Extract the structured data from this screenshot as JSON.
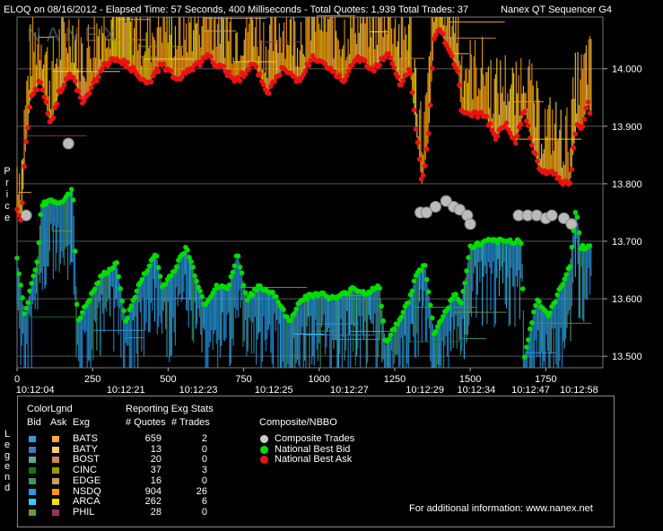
{
  "header": {
    "left": "ELOQ on 08/16/2012  -  Elapsed Time: 57 Seconds, 400 Milliseconds  -  Total Quotes: 1,939  Total Trades: 37",
    "right": "Nanex QT Sequencer G4"
  },
  "watermark": "NANEX",
  "yaxis_label": "Price",
  "legend_side_label": "Legend",
  "legend": {
    "title": "ColorLgnd",
    "stats_title": "Reporting Exg Stats",
    "col_bid": "Bid",
    "col_ask": "Ask",
    "col_exg": "Exg",
    "col_quotes": "# Quotes",
    "col_trades": "# Trades",
    "composite_title": "Composite/NBBO",
    "exchanges": [
      {
        "name": "BATS",
        "quotes": "659",
        "trades": "2",
        "bid_color": "#3399dd",
        "ask_color": "#ffaa33"
      },
      {
        "name": "BATY",
        "quotes": "13",
        "trades": "0",
        "bid_color": "#4477bb",
        "ask_color": "#ffcc66"
      },
      {
        "name": "BOST",
        "quotes": "20",
        "trades": "0",
        "bid_color": "#55aa99",
        "ask_color": "#cc8855"
      },
      {
        "name": "CINC",
        "quotes": "37",
        "trades": "3",
        "bid_color": "#117711",
        "ask_color": "#999900"
      },
      {
        "name": "EDGE",
        "quotes": "16",
        "trades": "0",
        "bid_color": "#339966",
        "ask_color": "#cc9966"
      },
      {
        "name": "NSDQ",
        "quotes": "904",
        "trades": "26",
        "bid_color": "#2299ee",
        "ask_color": "#ff9900"
      },
      {
        "name": "ARCA",
        "quotes": "262",
        "trades": "6",
        "bid_color": "#33ccff",
        "ask_color": "#ffdd00"
      },
      {
        "name": "PHIL",
        "quotes": "28",
        "trades": "0",
        "bid_color": "#669944",
        "ask_color": "#993366"
      }
    ],
    "composite": [
      {
        "label": "Composite Trades",
        "color": "#cccccc"
      },
      {
        "label": "National Best Bid",
        "color": "#00dd00"
      },
      {
        "label": "National Best Ask",
        "color": "#ee1111"
      }
    ],
    "footer": "For additional information: www.nanex.net"
  },
  "chart_data": {
    "type": "scatter",
    "title": "",
    "ylabel": "Price",
    "ylim": [
      13.48,
      14.09
    ],
    "xlim": [
      0,
      1939
    ],
    "y_ticks": [
      "13.500",
      "13.600",
      "13.700",
      "13.800",
      "13.900",
      "14.000"
    ],
    "x_ticks": [
      "0",
      "250",
      "500",
      "750",
      "1000",
      "1250",
      "1500",
      "1750"
    ],
    "time_labels": [
      {
        "quote": 60,
        "label": "10:12:04"
      },
      {
        "quote": 360,
        "label": "10:12:21"
      },
      {
        "quote": 600,
        "label": "10:12:23"
      },
      {
        "quote": 850,
        "label": "10:12:25"
      },
      {
        "quote": 1100,
        "label": "10:12:27"
      },
      {
        "quote": 1350,
        "label": "10:12:29"
      },
      {
        "quote": 1520,
        "label": "10:12:34"
      },
      {
        "quote": 1700,
        "label": "10:12:47"
      },
      {
        "quote": 1860,
        "label": "10:12:58"
      }
    ],
    "series": [
      {
        "name": "Composite Trades",
        "points": [
          [
            30,
            13.745
          ],
          [
            170,
            13.87
          ],
          [
            1335,
            13.75
          ],
          [
            1355,
            13.75
          ],
          [
            1385,
            13.76
          ],
          [
            1420,
            13.77
          ],
          [
            1445,
            13.76
          ],
          [
            1465,
            13.755
          ],
          [
            1490,
            13.745
          ],
          [
            1500,
            13.73
          ],
          [
            1660,
            13.745
          ],
          [
            1690,
            13.745
          ],
          [
            1720,
            13.745
          ],
          [
            1750,
            13.74
          ],
          [
            1770,
            13.745
          ],
          [
            1810,
            13.74
          ],
          [
            1835,
            13.73
          ]
        ]
      },
      {
        "name": "National Best Bid",
        "anchors": [
          [
            0,
            13.67
          ],
          [
            25,
            13.57
          ],
          [
            35,
            13.59
          ],
          [
            45,
            13.62
          ],
          [
            60,
            13.65
          ],
          [
            70,
            13.68
          ],
          [
            80,
            13.76
          ],
          [
            100,
            13.77
          ],
          [
            150,
            13.77
          ],
          [
            170,
            13.78
          ],
          [
            185,
            13.79
          ],
          [
            200,
            13.56
          ],
          [
            240,
            13.6
          ],
          [
            280,
            13.64
          ],
          [
            330,
            13.66
          ],
          [
            360,
            13.56
          ],
          [
            400,
            13.62
          ],
          [
            420,
            13.64
          ],
          [
            460,
            13.68
          ],
          [
            480,
            13.62
          ],
          [
            520,
            13.65
          ],
          [
            560,
            13.69
          ],
          [
            620,
            13.59
          ],
          [
            660,
            13.62
          ],
          [
            700,
            13.62
          ],
          [
            730,
            13.68
          ],
          [
            760,
            13.6
          ],
          [
            800,
            13.62
          ],
          [
            850,
            13.61
          ],
          [
            900,
            13.56
          ],
          [
            940,
            13.6
          ],
          [
            1000,
            13.61
          ],
          [
            1050,
            13.6
          ],
          [
            1090,
            13.61
          ],
          [
            1110,
            13.62
          ],
          [
            1150,
            13.61
          ],
          [
            1200,
            13.62
          ],
          [
            1220,
            13.52
          ],
          [
            1260,
            13.56
          ],
          [
            1300,
            13.6
          ],
          [
            1320,
            13.64
          ],
          [
            1350,
            13.66
          ],
          [
            1380,
            13.54
          ],
          [
            1420,
            13.58
          ],
          [
            1450,
            13.61
          ],
          [
            1470,
            13.59
          ],
          [
            1500,
            13.69
          ],
          [
            1560,
            13.7
          ],
          [
            1600,
            13.7
          ],
          [
            1650,
            13.7
          ],
          [
            1670,
            13.7
          ],
          [
            1680,
            13.5
          ],
          [
            1700,
            13.55
          ],
          [
            1720,
            13.6
          ],
          [
            1760,
            13.57
          ],
          [
            1800,
            13.62
          ],
          [
            1830,
            13.66
          ],
          [
            1850,
            13.76
          ],
          [
            1865,
            13.69
          ],
          [
            1900,
            13.69
          ]
        ]
      },
      {
        "name": "National Best Ask",
        "anchors": [
          [
            0,
            13.75
          ],
          [
            15,
            13.74
          ],
          [
            25,
            13.84
          ],
          [
            45,
            13.95
          ],
          [
            80,
            13.98
          ],
          [
            110,
            13.9
          ],
          [
            140,
            13.96
          ],
          [
            180,
            13.99
          ],
          [
            220,
            13.94
          ],
          [
            280,
            14.0
          ],
          [
            330,
            14.02
          ],
          [
            380,
            14.0
          ],
          [
            430,
            13.97
          ],
          [
            480,
            14.01
          ],
          [
            530,
            13.98
          ],
          [
            580,
            14.0
          ],
          [
            630,
            14.02
          ],
          [
            680,
            14.0
          ],
          [
            730,
            13.98
          ],
          [
            780,
            14.01
          ],
          [
            830,
            13.96
          ],
          [
            880,
            14.0
          ],
          [
            930,
            13.98
          ],
          [
            980,
            14.02
          ],
          [
            1030,
            14.0
          ],
          [
            1080,
            13.98
          ],
          [
            1130,
            14.02
          ],
          [
            1180,
            14.0
          ],
          [
            1230,
            14.03
          ],
          [
            1270,
            13.97
          ],
          [
            1300,
            14.0
          ],
          [
            1340,
            13.8
          ],
          [
            1360,
            13.87
          ],
          [
            1380,
            14.05
          ],
          [
            1400,
            14.07
          ],
          [
            1420,
            14.04
          ],
          [
            1440,
            14.02
          ],
          [
            1460,
            13.99
          ],
          [
            1470,
            13.93
          ],
          [
            1500,
            13.92
          ],
          [
            1550,
            13.92
          ],
          [
            1580,
            13.88
          ],
          [
            1620,
            13.9
          ],
          [
            1650,
            13.87
          ],
          [
            1680,
            13.93
          ],
          [
            1700,
            13.88
          ],
          [
            1730,
            13.82
          ],
          [
            1760,
            13.82
          ],
          [
            1780,
            13.82
          ],
          [
            1800,
            13.8
          ],
          [
            1830,
            13.8
          ],
          [
            1850,
            13.9
          ],
          [
            1870,
            13.9
          ],
          [
            1890,
            13.94
          ],
          [
            1900,
            13.92
          ]
        ]
      }
    ]
  }
}
